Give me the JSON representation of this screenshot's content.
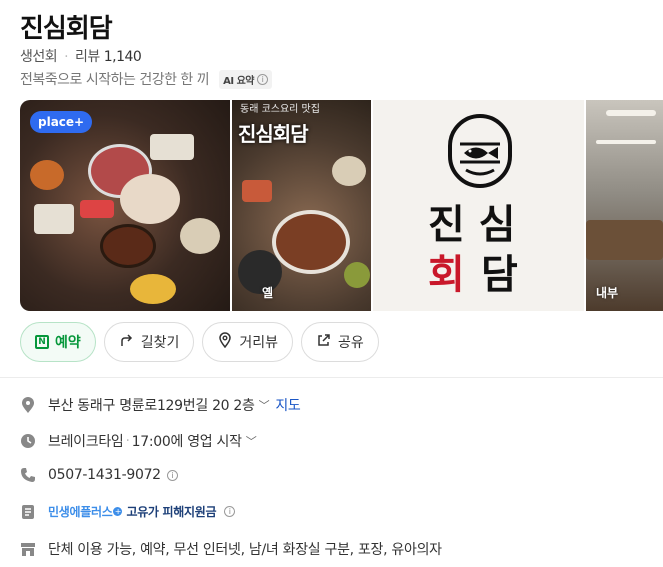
{
  "place": {
    "name": "진심회담",
    "category": "생선회",
    "review_label": "리뷰",
    "review_count": "1,140",
    "summary": "전복죽으로 시작하는 건강한 한 끼",
    "ai_badge": "AI 요약"
  },
  "gallery": {
    "badge": "place+",
    "photo2_sign": "진심회담",
    "photo2_subsign": "동래 코스요리 맛집",
    "photo2_caption": "옐",
    "logo_line1": "진 심",
    "logo_line2_red": "회",
    "logo_line2_black": "담",
    "photo4_caption": "내부"
  },
  "actions": {
    "reserve": "예약",
    "directions": "길찾기",
    "street_view": "거리뷰",
    "share": "공유"
  },
  "details": {
    "address": "부산 동래구 명륜로129번길 20 2층",
    "map_link": "지도",
    "break_label": "브레이크타임",
    "hours": "17:00에 영업 시작",
    "phone": "0507-1431-9072",
    "minsaeng": "민생에플러스",
    "gowon": "고유가 피해지원금",
    "amenities": "단체 이용 가능, 예약, 무선 인터넷, 남/녀 화장실 구분, 포장, 유아의자"
  },
  "colors": {
    "accent_green": "#06973b",
    "link_blue": "#1a56c6",
    "place_plus_blue": "#2f6bf0",
    "logo_red": "#c9182a"
  }
}
